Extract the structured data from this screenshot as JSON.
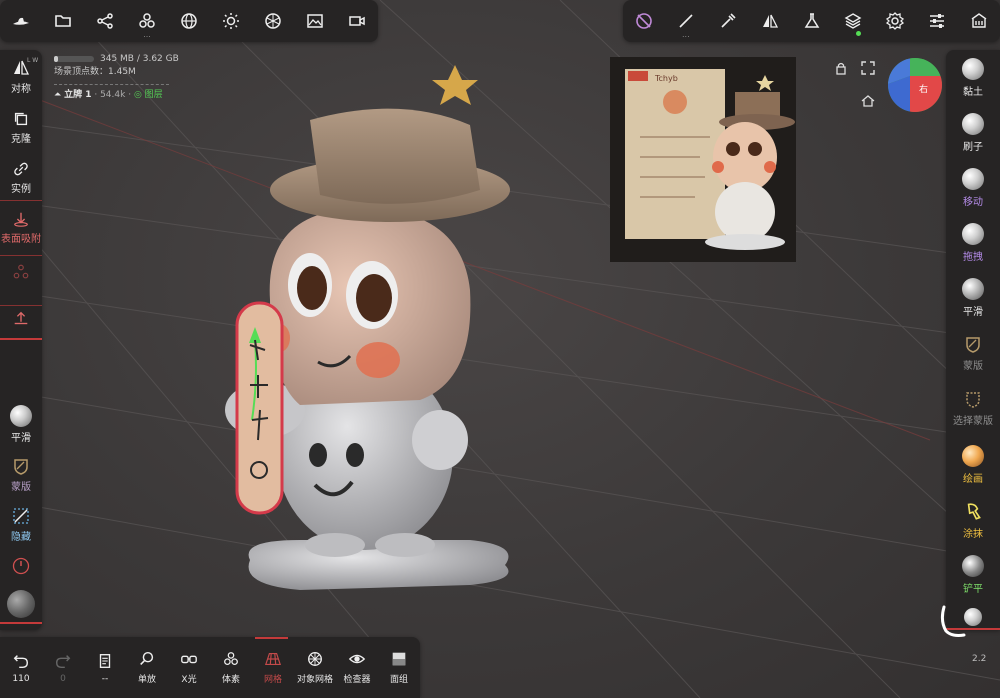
{
  "top_left_toolbar": {
    "icons": [
      "hat-icon",
      "folder-icon",
      "share-icon",
      "scene-icon",
      "sphere-icon",
      "light-icon",
      "material-icon",
      "image-icon",
      "video-icon"
    ]
  },
  "top_right_toolbar": {
    "icons": [
      "visibility-off-icon",
      "brush-tool-icon",
      "dropper-icon",
      "symmetry-icon",
      "flask-icon",
      "layers-icon",
      "settings-icon",
      "sliders-icon",
      "gallery-icon"
    ]
  },
  "stats": {
    "memory": "345 MB / 3.62 GB",
    "memory_fraction": 0.095,
    "vertex_count": "场景顶点数：1.45M",
    "object_name": "立牌 1",
    "object_verts": "· 54.4k ·",
    "layer_label": "图层"
  },
  "left_toolbar": {
    "items": [
      {
        "label": "对称",
        "sublabel": "L W",
        "icon": "symmetry-icon"
      },
      {
        "label": "克隆",
        "icon": "clone-icon"
      },
      {
        "label": "实例",
        "icon": "link-icon"
      },
      {
        "label": "表面吸附",
        "icon": "snap-icon"
      },
      {
        "label": "",
        "icon": "nodes-icon"
      },
      {
        "label": "",
        "icon": "pivot-icon"
      },
      {
        "label": "平滑",
        "icon": "smooth-icon"
      },
      {
        "label": "蒙版",
        "icon": "mask-icon"
      },
      {
        "label": "隐藏",
        "icon": "hide-icon"
      },
      {
        "label": "",
        "icon": "gauge-icon"
      },
      {
        "label": "",
        "icon": "material-preview-icon"
      }
    ]
  },
  "right_toolbar": {
    "items": [
      {
        "label": "黏土",
        "color": "#e6e6e6"
      },
      {
        "label": "刷子",
        "color": "#e6e6e6"
      },
      {
        "label": "移动",
        "color": "#b48be8"
      },
      {
        "label": "拖拽",
        "color": "#b48be8"
      },
      {
        "label": "平滑",
        "color": "#e6e6e6"
      },
      {
        "label": "蒙版",
        "color": "#8e8e8e"
      },
      {
        "label": "选择蒙版",
        "color": "#8e8e8e"
      },
      {
        "label": "绘画",
        "color": "#f0c040"
      },
      {
        "label": "涂抹",
        "color": "#f0c040"
      },
      {
        "label": "铲平",
        "color": "#7ee06a"
      }
    ]
  },
  "bottom_toolbar": {
    "items": [
      {
        "label": "110",
        "icon": "undo-icon"
      },
      {
        "label": "0",
        "icon": "redo-icon"
      },
      {
        "label": "--",
        "icon": "history-icon"
      },
      {
        "label": "单放",
        "icon": "search-icon"
      },
      {
        "label": "X光",
        "icon": "xray-icon"
      },
      {
        "label": "体素",
        "icon": "voxel-icon"
      },
      {
        "label": "网格",
        "icon": "grid-icon"
      },
      {
        "label": "对象网格",
        "icon": "object-grid-icon"
      },
      {
        "label": "检查器",
        "icon": "inspector-icon"
      },
      {
        "label": "面组",
        "icon": "facegroup-icon"
      }
    ]
  },
  "gizmo": {
    "label": "右"
  },
  "version": "2.2",
  "colors": {
    "accent_red": "#c43a3a",
    "toolbar_bg": "#262424",
    "snap_red": "#e06a6a"
  }
}
